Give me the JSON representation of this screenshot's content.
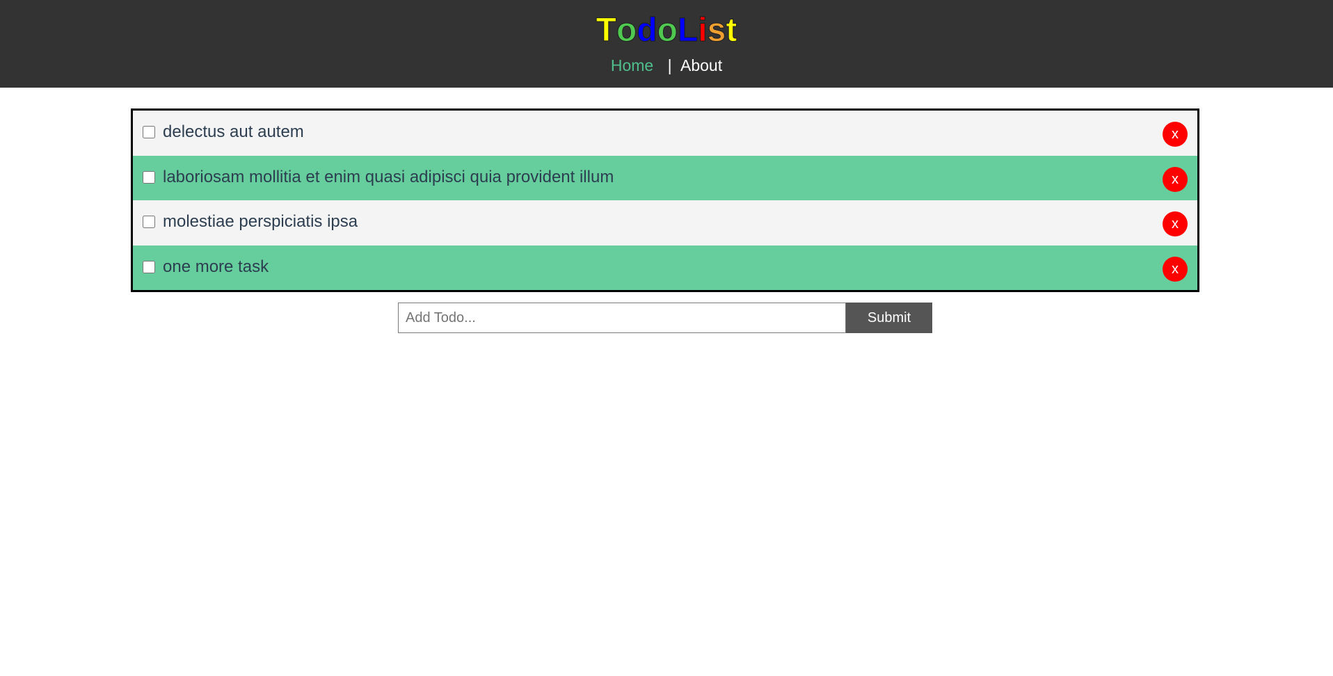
{
  "header": {
    "logo_letters": [
      {
        "char": "T",
        "color": "#ffff00"
      },
      {
        "char": "o",
        "color": "#4fc94f"
      },
      {
        "char": "d",
        "color": "#0000ff"
      },
      {
        "char": "o",
        "color": "#4fc94f"
      },
      {
        "char": "L",
        "color": "#0000ff"
      },
      {
        "char": "i",
        "color": "#ff0000"
      },
      {
        "char": "s",
        "color": "#f0a030"
      },
      {
        "char": "t",
        "color": "#ffff00"
      }
    ],
    "nav": {
      "home_label": "Home",
      "separator": "|",
      "about_label": "About"
    }
  },
  "todos": [
    {
      "title": "delectus aut autem",
      "completed": false,
      "delete_label": "x"
    },
    {
      "title": "laboriosam mollitia et enim quasi adipisci quia provident illum",
      "completed": false,
      "delete_label": "x"
    },
    {
      "title": "molestiae perspiciatis ipsa",
      "completed": false,
      "delete_label": "x"
    },
    {
      "title": "one more task",
      "completed": false,
      "delete_label": "x"
    }
  ],
  "add_form": {
    "placeholder": "Add Todo...",
    "value": "",
    "submit_label": "Submit"
  },
  "colors": {
    "header_bg": "#333333",
    "row_light": "#f4f4f4",
    "row_green": "#66cd9d",
    "delete_button": "#ff0000",
    "submit_button": "#555555",
    "home_link": "#4fc08d"
  }
}
